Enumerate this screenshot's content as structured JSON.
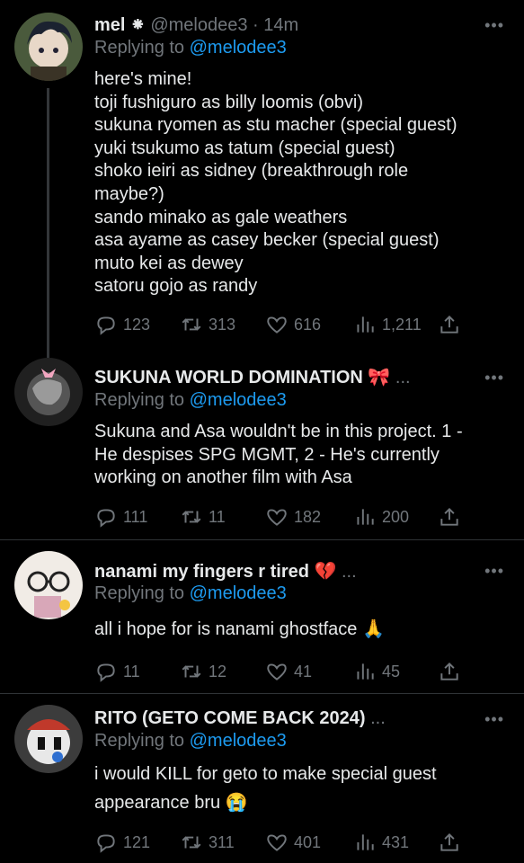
{
  "tweets": [
    {
      "name": "mel ⁕",
      "handle": "@melodee3 · 14m",
      "replying_prefix": "Replying to ",
      "replying_to": "@melodee3",
      "lines": [
        "here's mine!",
        "toji fushiguro as billy loomis (obvi)",
        "sukuna ryomen as stu macher (special guest)",
        "yuki tsukumo as tatum (special guest)",
        "shoko ieiri as sidney (breakthrough role",
        "maybe?)",
        "sando minako as gale weathers",
        "asa ayame as casey becker (special guest)",
        "muto kei as dewey",
        "satoru gojo as randy"
      ],
      "replies": "123",
      "retweets": "313",
      "likes": "616",
      "views": "1,211"
    },
    {
      "name": "SUKUNA WORLD DOMINATION 🎀",
      "handle": "...",
      "replying_prefix": "Replying to ",
      "replying_to": "@melodee3",
      "lines": [
        "Sukuna and Asa wouldn't be in this project. 1 -",
        "He despises SPG MGMT, 2 - He's currently",
        "working on another film with Asa"
      ],
      "replies": "111",
      "retweets": "11",
      "likes": "182",
      "views": "200"
    },
    {
      "name": "nanami my fingers r tired 💔",
      "handle": "...",
      "replying_prefix": "Replying to ",
      "replying_to": "@melodee3",
      "lines": [
        "all i hope for is nanami ghostface 🙏"
      ],
      "replies": "11",
      "retweets": "12",
      "likes": "41",
      "views": "45"
    },
    {
      "name": "RITO (GETO COME BACK 2024)",
      "handle": "...",
      "replying_prefix": "Replying to ",
      "replying_to": "@melodee3",
      "lines": [
        "i would KILL for geto to make special guest",
        "appearance bru 😭"
      ],
      "replies": "121",
      "retweets": "311",
      "likes": "401",
      "views": "431"
    }
  ],
  "more_label": "•••",
  "icons": [
    "reply-icon",
    "retweet-icon",
    "like-icon",
    "views-icon",
    "share-icon",
    "more-icon"
  ]
}
